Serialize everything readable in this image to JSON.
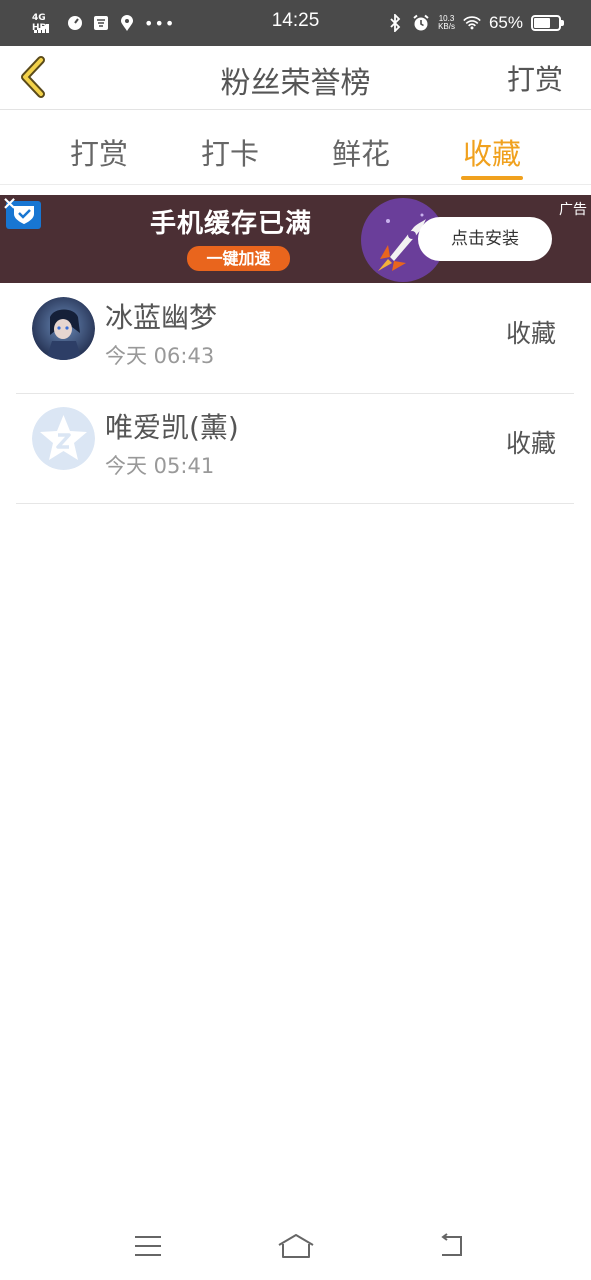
{
  "status_bar": {
    "network": "4G HD",
    "time": "14:25",
    "speed_value": "10.3",
    "speed_unit": "KB/s",
    "battery_percent": "65%",
    "battery_level": 0.65,
    "icons": [
      "speedometer-icon",
      "app-icon",
      "location-icon",
      "more-dots-icon",
      "bluetooth-icon",
      "alarm-icon",
      "wifi-icon",
      "battery-icon"
    ]
  },
  "header": {
    "title": "粉丝荣誉榜",
    "action_label": "打赏"
  },
  "tabs": [
    {
      "label": "打赏",
      "active": false
    },
    {
      "label": "打卡",
      "active": false
    },
    {
      "label": "鲜花",
      "active": false
    },
    {
      "label": "收藏",
      "active": true
    }
  ],
  "ad": {
    "headline": "手机缓存已满",
    "pill": "一键加速",
    "cta": "点击安装",
    "tag": "广告",
    "close": "×"
  },
  "list": [
    {
      "name": "冰蓝幽梦",
      "time": "今天 06:43",
      "action": "收藏"
    },
    {
      "name": "唯爱凯(薰)",
      "time": "今天 05:41",
      "action": "收藏"
    }
  ],
  "colors": {
    "accent": "#f0a11e",
    "status_bar": "#4a4a4a",
    "ad_background": "#4b2f34"
  }
}
